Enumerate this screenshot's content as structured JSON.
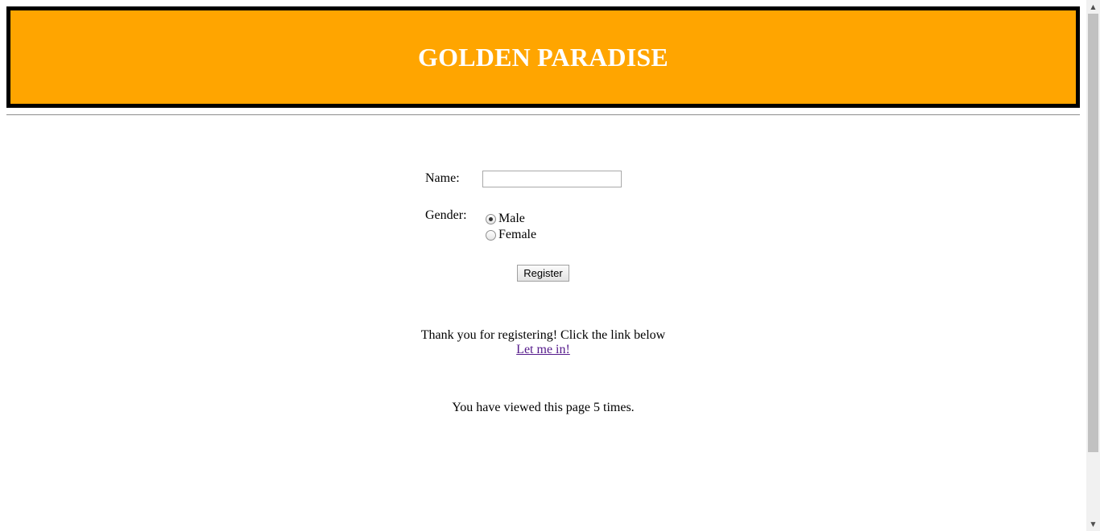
{
  "header": {
    "title": "GOLDEN PARADISE",
    "background_color": "#ffa500",
    "border_color": "#000000",
    "title_color": "#ffffff"
  },
  "form": {
    "name_label": "Name:",
    "name_value": "",
    "gender_label": "Gender:",
    "gender_options": [
      {
        "label": "Male",
        "checked": true
      },
      {
        "label": "Female",
        "checked": false
      }
    ],
    "register_label": "Register"
  },
  "message": {
    "thanks_text": "Thank you for registering! Click the link below",
    "link_text": "Let me in!",
    "link_color": "#551a8b"
  },
  "counter": {
    "text": "You have viewed this page 5 times."
  },
  "icons": {
    "scroll_up": "scroll-up-arrow-icon",
    "scroll_down": "scroll-down-arrow-icon"
  }
}
